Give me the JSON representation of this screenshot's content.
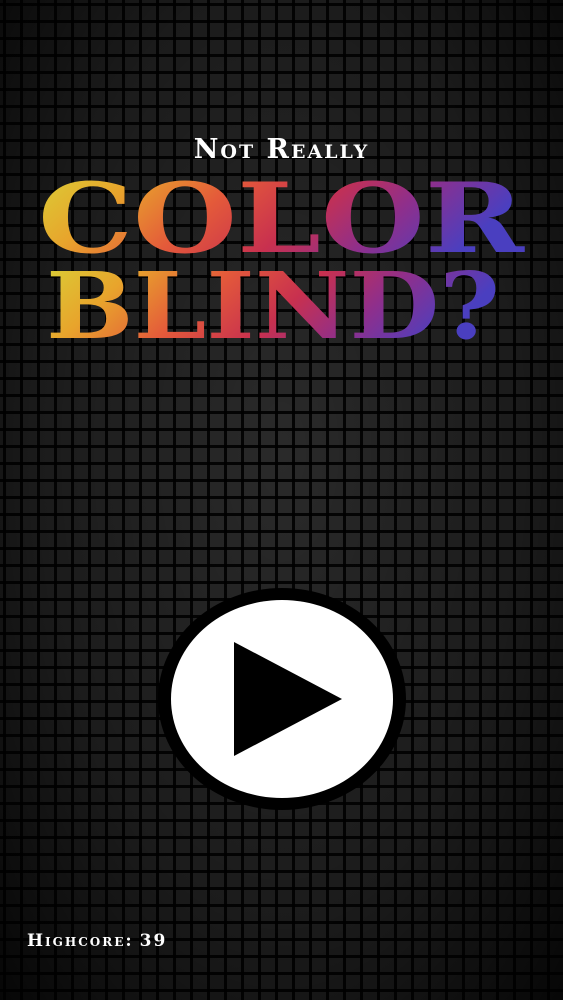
{
  "subtitle": "Not Really",
  "title": {
    "line1": "COLOR",
    "line2": "BLIND?",
    "gradient_colors": [
      "#d4d136",
      "#e89a2a",
      "#e0553a",
      "#c8324d",
      "#8a2f8a",
      "#4a3fb8"
    ]
  },
  "play_button": {
    "icon": "play-icon",
    "ring_color": "#000000",
    "disc_color": "#ffffff"
  },
  "highscore": {
    "label": "Highcore:",
    "value": "39"
  }
}
